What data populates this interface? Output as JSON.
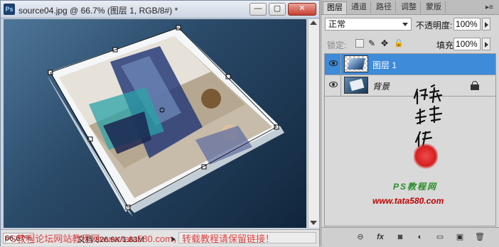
{
  "document": {
    "title": "source04.jpg @ 66.7% (图层 1, RGB/8#) *",
    "app_icon": "Ps",
    "zoom": "66.67%",
    "doc_info": "文档:826.9K/1.83M"
  },
  "panels": {
    "tabs": [
      "图层",
      "通道",
      "路径",
      "调整",
      "蒙版"
    ],
    "blend_mode": "正常",
    "opacity_label": "不透明度:",
    "opacity_value": "100%",
    "lock_label": "锁定:",
    "fill_label": "填充:",
    "fill_value": "100%",
    "layers": [
      {
        "name": "图层 1",
        "selected": true
      },
      {
        "name": "背景",
        "locked": true
      }
    ],
    "bottom_icons": [
      "link-icon",
      "fx-icon",
      "mask-icon",
      "adjustment-icon",
      "group-icon",
      "new-layer-icon",
      "trash-icon"
    ],
    "bottom_icon_glyphs": [
      "⊖",
      "fx",
      "◙",
      "◐",
      "▭",
      "▣",
      "🗑"
    ]
  },
  "watermarks": {
    "ps_text": "PS教程网",
    "site_text": "www.tata580.com",
    "bottom_text": "PS教程论坛网站教程网www.tata580.com，转载教程请保留链接！"
  },
  "colors": {
    "selected_layer": "#3d8bd9",
    "canvas_bg": "#1e3a58",
    "watermark_red": "#c00000",
    "watermark_green": "#2a8d2a"
  }
}
